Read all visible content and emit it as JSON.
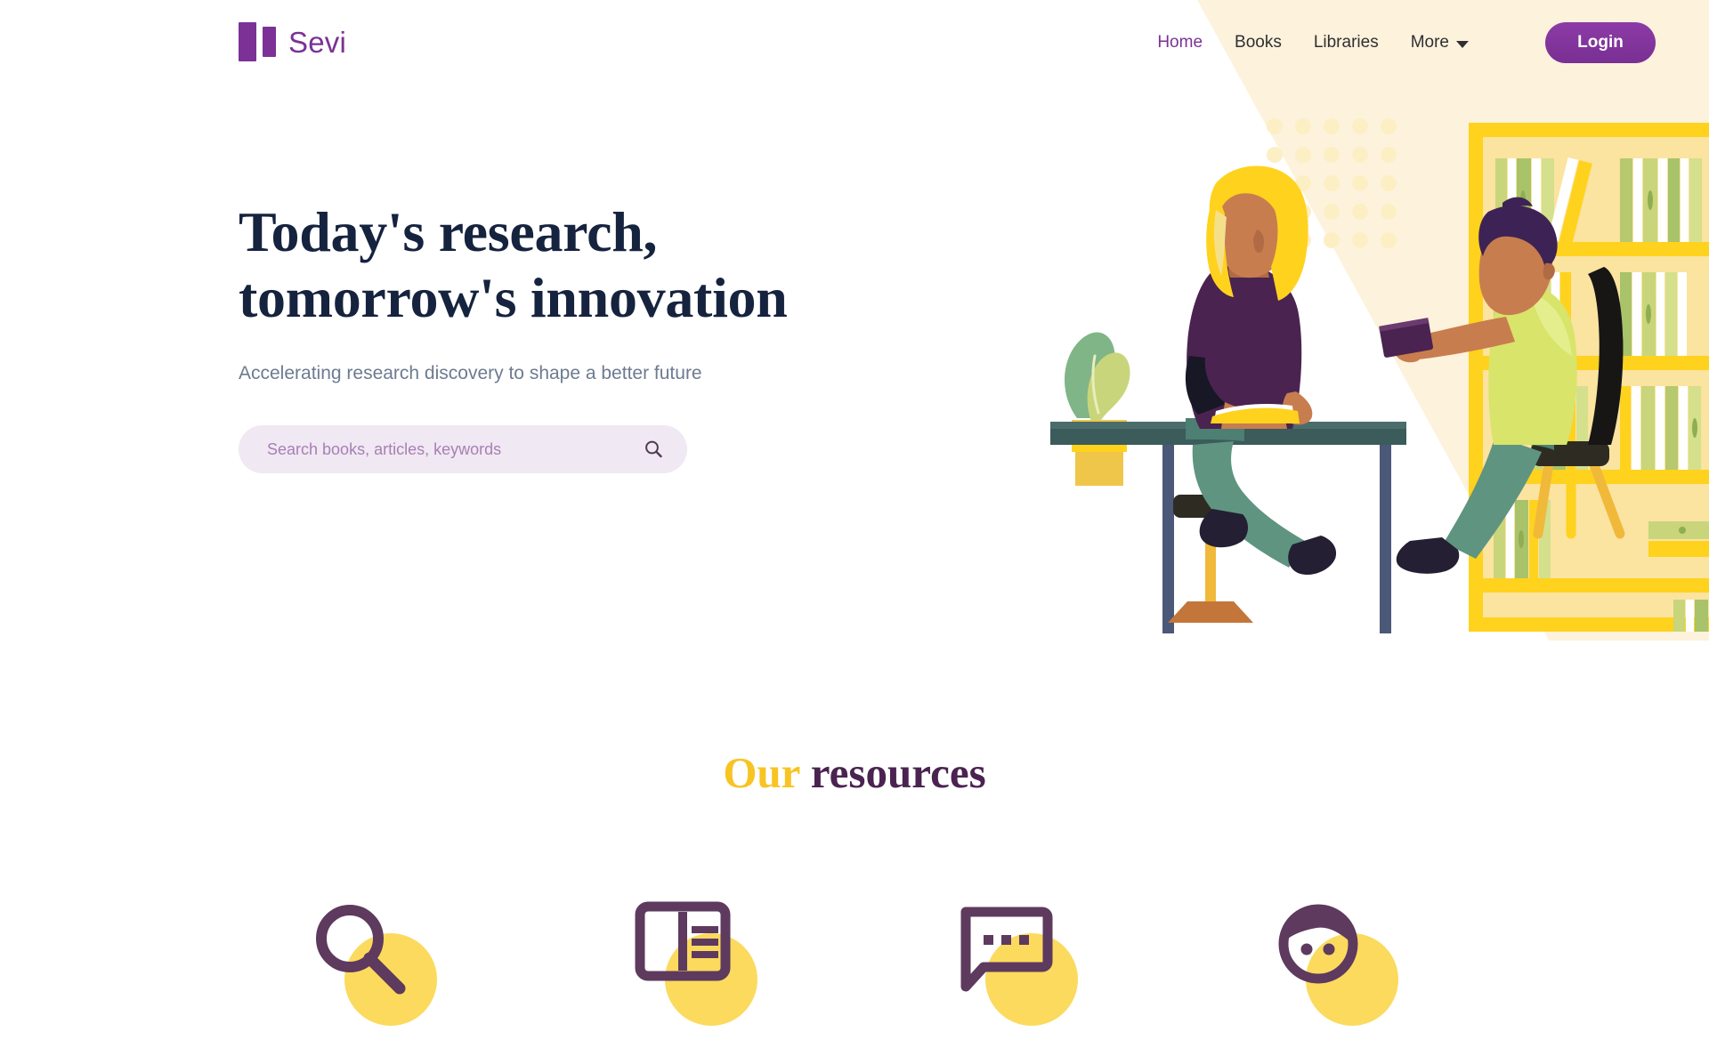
{
  "brand": {
    "name": "Sevi",
    "logo_icon": "two-bar-logo-icon",
    "color": "#7b3196"
  },
  "nav": {
    "links": [
      {
        "label": "Home",
        "active": true
      },
      {
        "label": "Books",
        "active": false
      },
      {
        "label": "Libraries",
        "active": false
      }
    ],
    "more": {
      "label": "More",
      "icon": "chevron-down-icon"
    },
    "login": {
      "label": "Login",
      "color": "#7b3196"
    }
  },
  "hero": {
    "title_line1": "Today's research,",
    "title_line2": "tomorrow's innovation",
    "subtitle": "Accelerating research discovery to shape a better future",
    "title_color": "#16233f",
    "subtitle_color": "#6d7b90",
    "illustration": "library-reading-illustration"
  },
  "search": {
    "value": "",
    "placeholder": "Search books, articles, keywords",
    "icon": "search-icon",
    "background": "#f0e8f2"
  },
  "resources": {
    "title_accent": "Our",
    "title_rest": " resources",
    "accent_color": "#f8c423",
    "title_color": "#4a2350",
    "blob_color": "#fbda5d",
    "glyph_color": "#5d3a5e",
    "items": [
      {
        "icon": "search-magnifier-icon"
      },
      {
        "icon": "open-book-icon"
      },
      {
        "icon": "chat-bubble-icon"
      },
      {
        "icon": "person-face-icon"
      }
    ]
  }
}
